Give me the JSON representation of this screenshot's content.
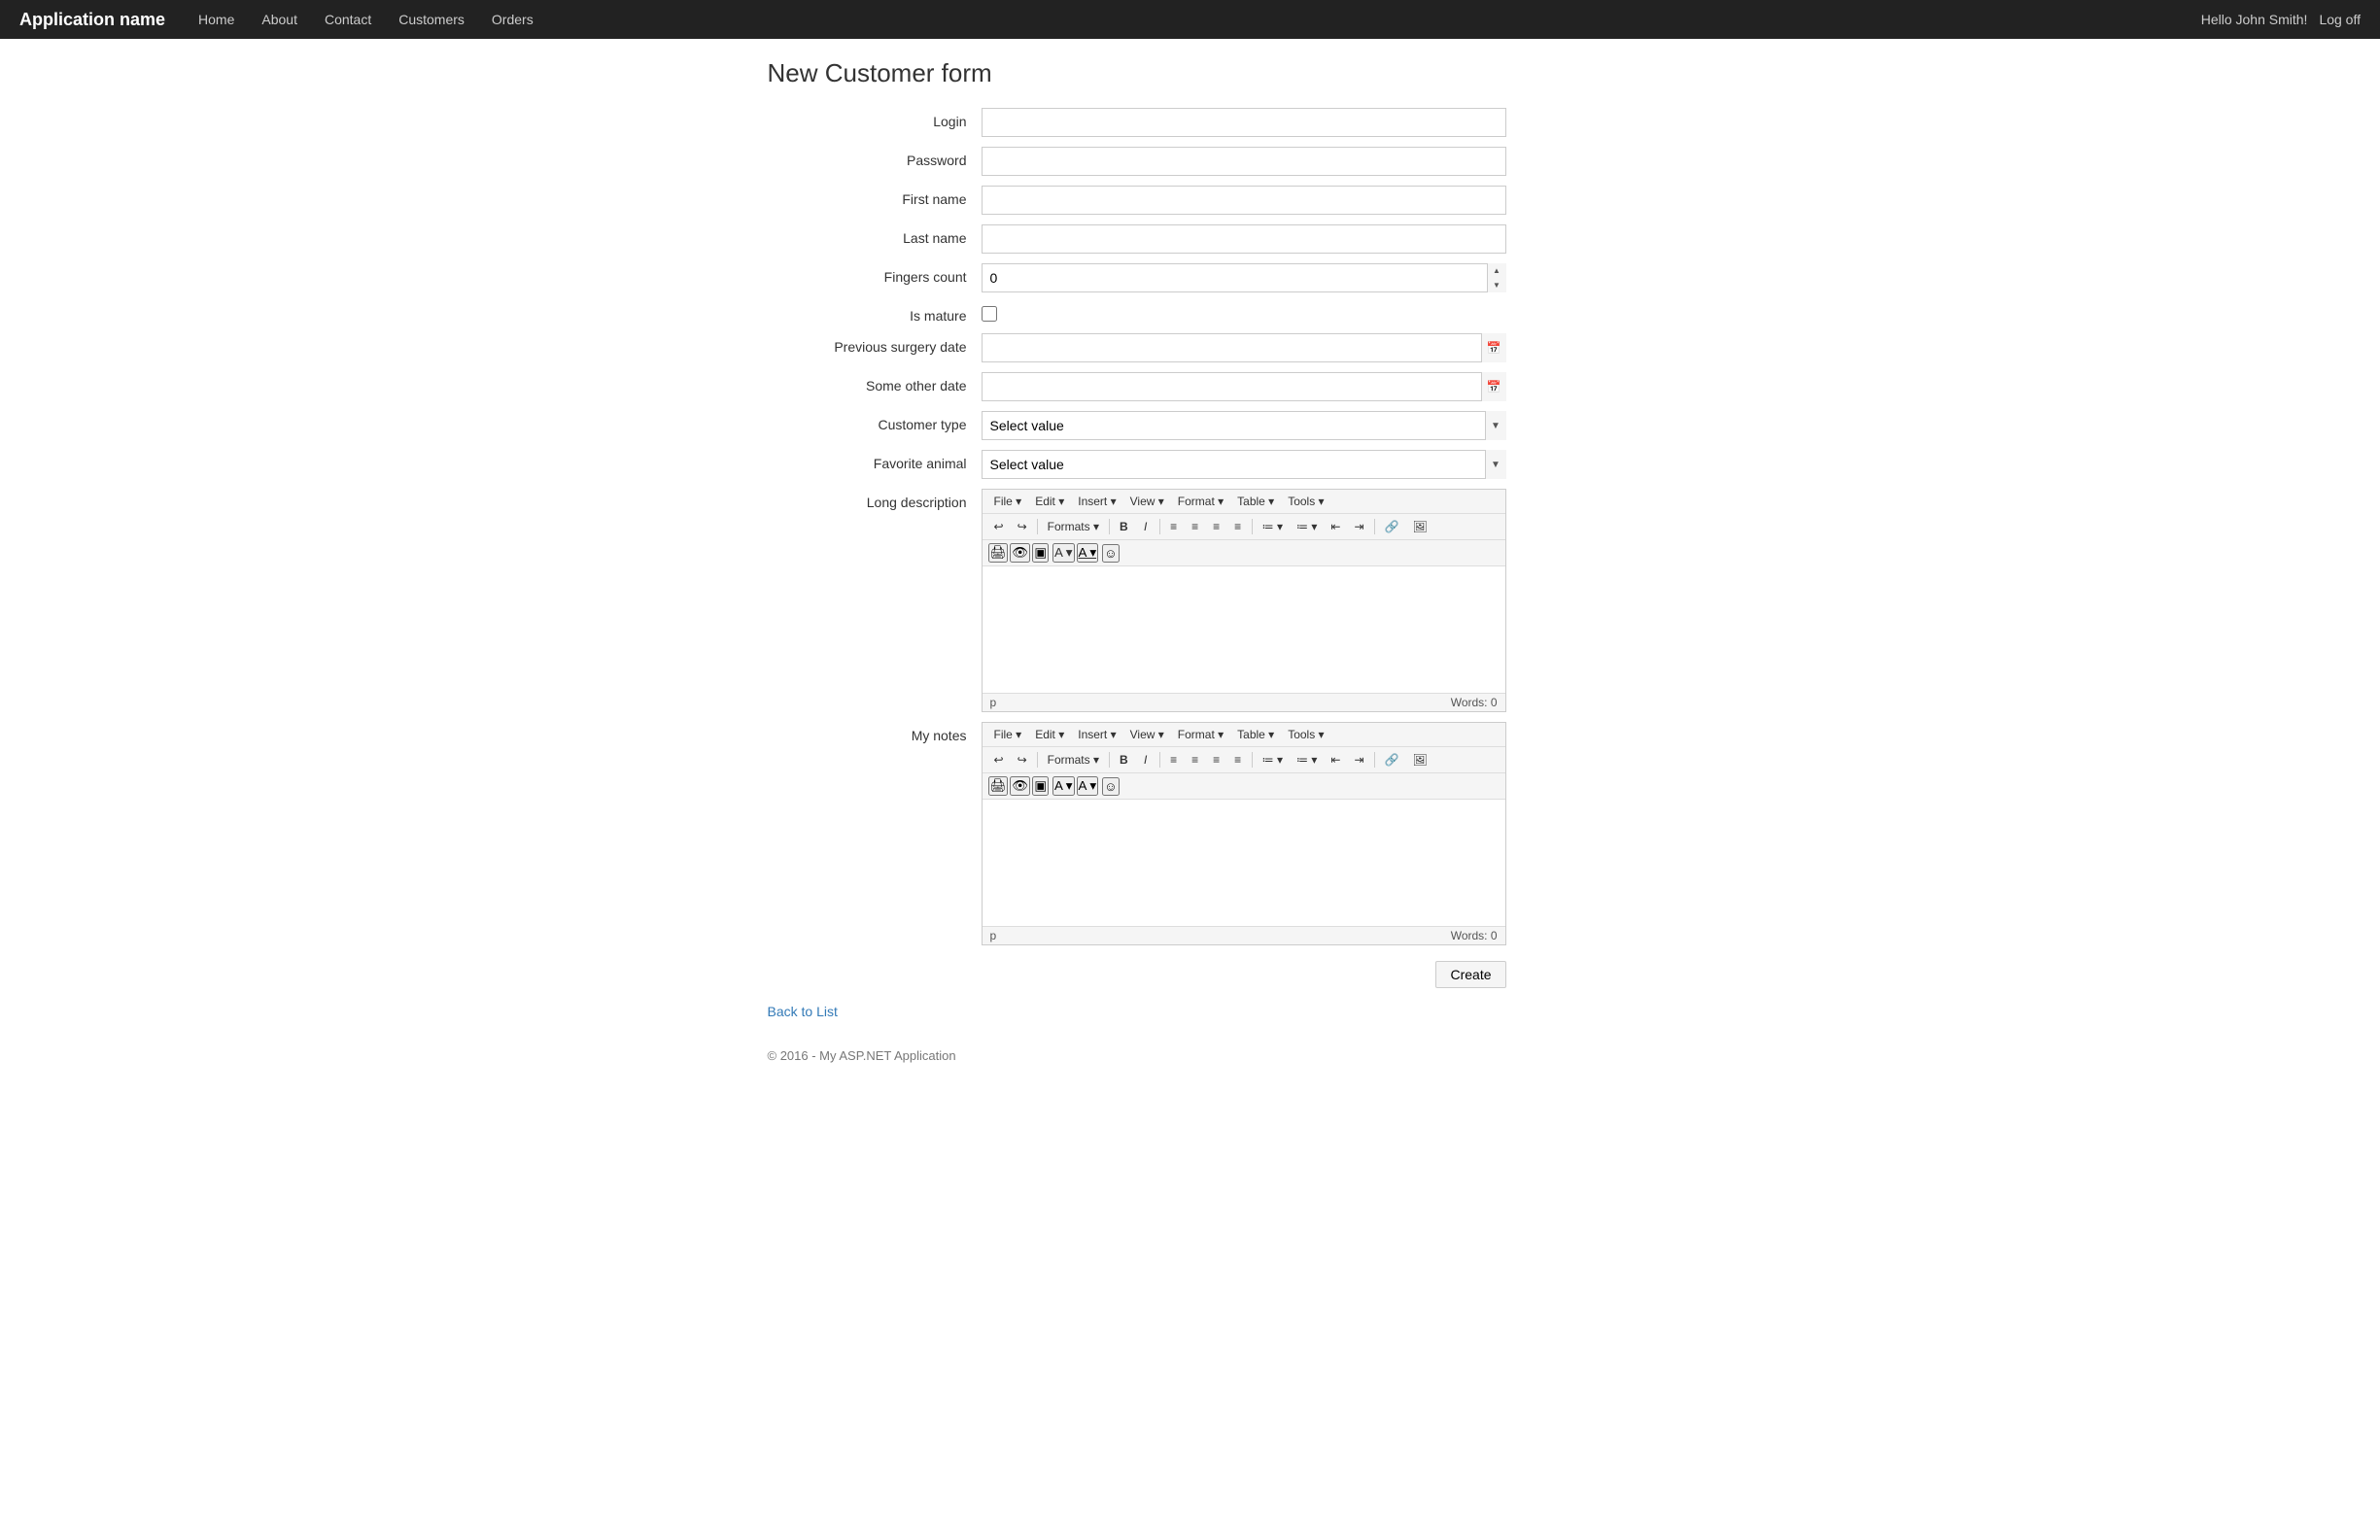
{
  "app": {
    "brand": "Application name",
    "nav": [
      "Home",
      "About",
      "Contact",
      "Customers",
      "Orders"
    ],
    "user_greeting": "Hello John Smith!",
    "logoff": "Log off"
  },
  "form": {
    "title": "New Customer form",
    "fields": {
      "login_label": "Login",
      "password_label": "Password",
      "firstname_label": "First name",
      "lastname_label": "Last name",
      "fingers_label": "Fingers count",
      "fingers_value": "0",
      "ismature_label": "Is mature",
      "prev_surgery_label": "Previous surgery date",
      "other_date_label": "Some other date",
      "customer_type_label": "Customer type",
      "customer_type_placeholder": "Select value",
      "favorite_animal_label": "Favorite animal",
      "favorite_animal_placeholder": "Select value",
      "long_desc_label": "Long description",
      "my_notes_label": "My notes"
    },
    "editor": {
      "menu": [
        "File",
        "Edit",
        "Insert",
        "View",
        "Format",
        "Table",
        "Tools"
      ],
      "formats_label": "Formats",
      "words_label": "Words: 0",
      "p_label": "p"
    },
    "create_button": "Create",
    "back_link": "Back to List"
  },
  "footer": {
    "text": "© 2016 - My ASP.NET Application"
  }
}
